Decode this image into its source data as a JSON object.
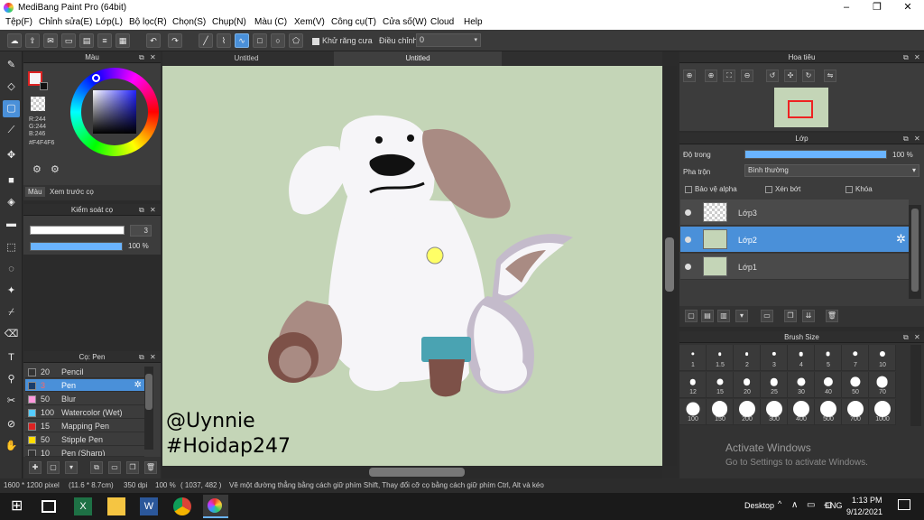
{
  "window": {
    "title": "MediBang Paint Pro (64bit)",
    "min": "–",
    "max": "❐",
    "close": "✕"
  },
  "menu": [
    "Tệp(F)",
    "Chỉnh sửa(E)",
    "Lớp(L)",
    "Bộ lọc(R)",
    "Chọn(S)",
    "Chụp(N)",
    "Màu (C)",
    "Xem(V)",
    "Công cụ(T)",
    "Cửa số(W)",
    "Cloud",
    "Help"
  ],
  "toolbar": {
    "antialias_label": "Khử răng cưa",
    "adjust_label": "Điều chỉnh",
    "adjust_value": "0"
  },
  "color_panel": {
    "title": "Màu",
    "r": "R:244",
    "g": "G:244",
    "b": "B:246",
    "hex": "#F4F4F6",
    "tab_color": "Màu",
    "tab_preview": "Xem trước cọ",
    "primary_color": "#f4f4f6"
  },
  "brush_control": {
    "title": "Kiểm soát cọ",
    "size_value": "3",
    "opacity_value": "100 %",
    "opacity": 1.0
  },
  "brush_list": {
    "title": "Cọ: Pen",
    "items": [
      {
        "size": "20",
        "name": "Pencil",
        "color": "#333333"
      },
      {
        "size": "3",
        "name": "Pen",
        "color": "#1a3c6a"
      },
      {
        "size": "50",
        "name": "Blur",
        "color": "#ff99dd"
      },
      {
        "size": "100",
        "name": "Watercolor (Wet)",
        "color": "#55ccff"
      },
      {
        "size": "15",
        "name": "Mapping Pen",
        "color": "#dd2222"
      },
      {
        "size": "50",
        "name": "Stipple Pen",
        "color": "#ffdd00"
      },
      {
        "size": "10",
        "name": "Pen (Sharp)",
        "color": "#333333"
      }
    ]
  },
  "tabs": [
    "Untitled",
    "Untitled"
  ],
  "canvas": {
    "signature_line1": "@Uynnie",
    "signature_line2": "#Hoidap247",
    "background": "#c4d5b7"
  },
  "navigator": {
    "title": "Hoa tiêu"
  },
  "layer_panel": {
    "title": "Lớp",
    "opacity_label": "Độ trong",
    "opacity_value": "100 %",
    "opacity": 1.0,
    "blend_label": "Pha trộn",
    "blend_value": "Bình thường",
    "protect_alpha": "Bảo vệ alpha",
    "clipping": "Xén bớt",
    "lock": "Khóa",
    "layers": [
      {
        "name": "Lớp3",
        "thumb": "checker"
      },
      {
        "name": "Lớp2",
        "thumb": "drawing"
      },
      {
        "name": "Lớp1",
        "thumb": "green"
      }
    ]
  },
  "brush_size": {
    "title": "Brush Size",
    "sizes": [
      "1",
      "1.5",
      "2",
      "3",
      "4",
      "5",
      "7",
      "10",
      "12",
      "15",
      "20",
      "25",
      "30",
      "40",
      "50",
      "70",
      "100",
      "150",
      "200",
      "300",
      "400",
      "500",
      "700",
      "1000"
    ]
  },
  "status": {
    "dims": "1600 * 1200 pixel",
    "cm": "(11.6 * 8.7cm)",
    "dpi": "350 dpi",
    "zoom": "100 %",
    "coords": "( 1037, 482 )",
    "hint": "Vẽ một đường thẳng bằng cách giữ phím Shift, Thay đổi cỡ cọ bằng cách giữ phím Ctrl, Alt và kéo"
  },
  "watermark": {
    "line1": "Activate Windows",
    "line2": "Go to Settings to activate Windows."
  },
  "taskbar": {
    "desktop": "Desktop",
    "lang": "ENG",
    "time": "1:13 PM",
    "date": "9/12/2021"
  }
}
